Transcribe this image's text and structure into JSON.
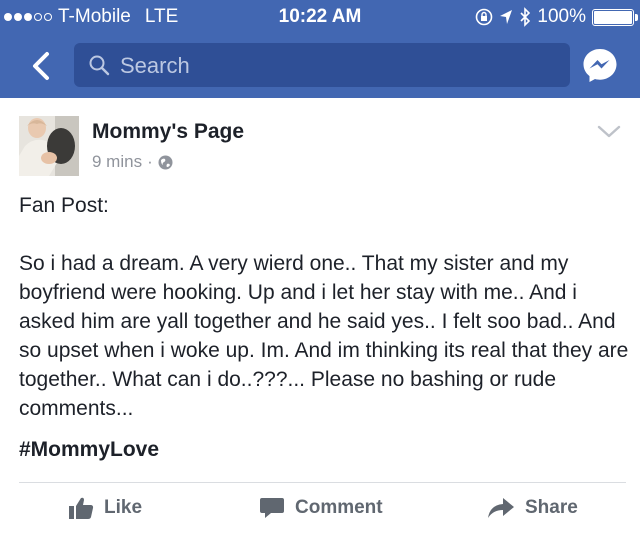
{
  "status_bar": {
    "carrier": "T-Mobile",
    "network": "LTE",
    "time": "10:22 AM",
    "battery": "100%",
    "battery_level": 1.0,
    "signal_bars_filled": 3,
    "signal_bars_total": 5
  },
  "nav": {
    "search_placeholder": "Search"
  },
  "post": {
    "author": "Mommy's Page",
    "time": "9 mins",
    "separator": "·",
    "lines_intro": "Fan Post:",
    "body": "So i had a dream. A very wierd one.. That my sister and my boyfriend were hooking. Up and i let her stay with me.. And i asked him are yall together and he said yes.. I felt soo bad.. And so upset when i woke up. Im. And im thinking its real that they are together.. What can i do..???... Please no bashing or rude comments...",
    "hashtag": "#MommyLove"
  },
  "actions": {
    "like": "Like",
    "comment": "Comment",
    "share": "Share"
  },
  "colors": {
    "brand": "#4267b2",
    "search_bg": "#2f4f96",
    "muted": "#90949c",
    "action": "#606770"
  }
}
